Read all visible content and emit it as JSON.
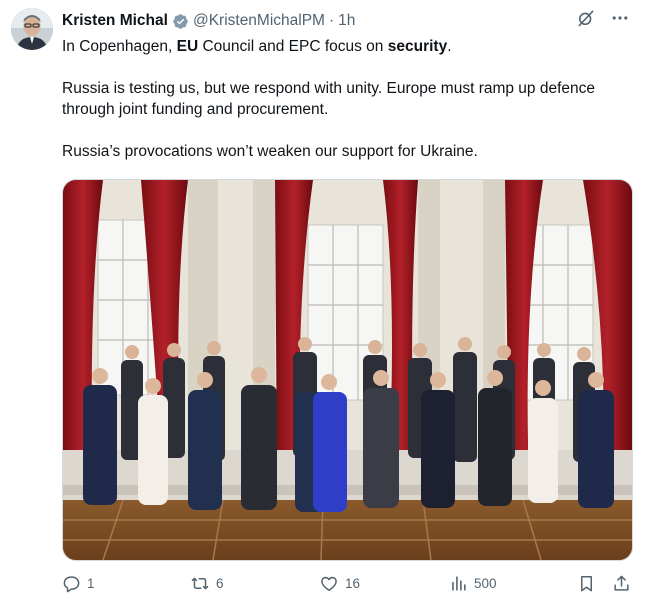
{
  "post": {
    "author_name": "Kristen Michal",
    "handle": "@KristenMichalPM",
    "separator": "·",
    "time": "1h",
    "text": {
      "line1_pre": "In Copenhagen, ",
      "line1_bold1": "EU",
      "line1_mid": " Council and EPC focus on ",
      "line1_bold2": "security",
      "line1_post": ".",
      "paragraph2": "Russia is testing us, but we respond with unity. Europe must ramp up defence through joint funding and procurement.",
      "paragraph3": "Russia’s provocations won’t weaken our support for Ukraine."
    },
    "media": {
      "kind": "photo",
      "description_icon": "group-photo"
    },
    "stats": {
      "replies": "1",
      "reposts": "6",
      "likes": "16",
      "views": "500"
    }
  },
  "colors": {
    "text": "#0f1419",
    "secondary": "#536471",
    "verified": "#829aab",
    "border": "#cfd9de"
  },
  "icons": [
    "verified-badge-icon",
    "grok-icon",
    "more-icon",
    "reply-icon",
    "repost-icon",
    "like-icon",
    "views-icon",
    "bookmark-icon",
    "share-icon"
  ]
}
